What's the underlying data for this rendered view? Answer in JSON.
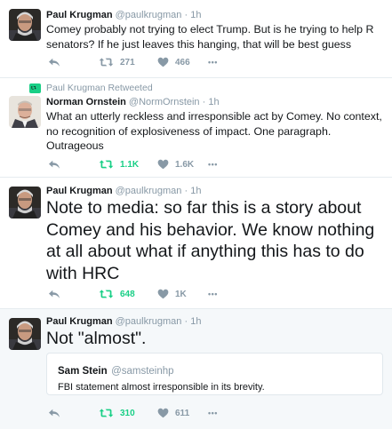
{
  "tweets": [
    {
      "name": "Paul Krugman",
      "handle": "@paulkrugman",
      "dot": "·",
      "time": "1h",
      "text": "Comey probably not trying to elect Trump. But is he trying to help R senators? If he just leaves this hanging, that will be best guess",
      "retweets": "271",
      "likes": "466",
      "more": "•••"
    },
    {
      "context": "Paul Krugman Retweeted",
      "name": "Norman Ornstein",
      "handle": "@NormOrnstein",
      "dot": "·",
      "time": "1h",
      "text": "What an utterly reckless and irresponsible act by Comey. No context, no recognition of explosiveness of impact. One paragraph. Outrageous",
      "retweets": "1.1K",
      "likes": "1.6K",
      "more": "•••"
    },
    {
      "name": "Paul Krugman",
      "handle": "@paulkrugman",
      "dot": "·",
      "time": "1h",
      "text": "Note to media: so far this is a story about Comey and his behavior. We know nothing at all about what if anything this has to do with HRC",
      "retweets": "648",
      "likes": "1K",
      "more": "•••"
    },
    {
      "name": "Paul Krugman",
      "handle": "@paulkrugman",
      "dot": "·",
      "time": "1h",
      "text": "Not \"almost\".",
      "quote": {
        "name": "Sam Stein",
        "handle": "@samsteinhp",
        "text": "FBI statement almost irresponsible in its brevity."
      },
      "retweets": "310",
      "likes": "611",
      "more": "•••"
    }
  ],
  "colors": {
    "retweeted": "#19cf86",
    "muted": "#8899a6",
    "divider": "#e6ecf0"
  },
  "icons": [
    "reply-icon",
    "retweet-icon",
    "like-heart-icon",
    "more-icon",
    "avatar"
  ]
}
